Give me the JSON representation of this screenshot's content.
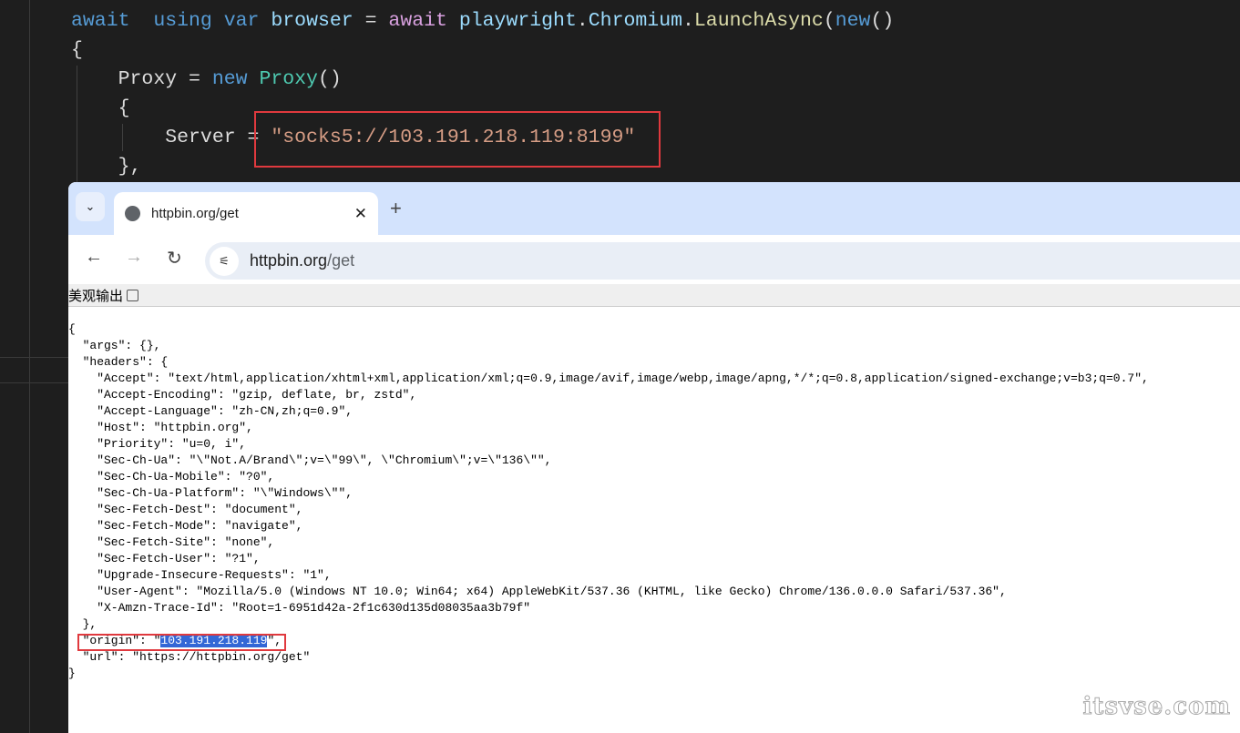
{
  "editor": {
    "lines": [
      {
        "parts": [
          [
            "kw",
            "await"
          ],
          [
            "",
            "  "
          ],
          [
            "kw",
            "using"
          ],
          [
            "",
            " "
          ],
          [
            "kw",
            "var"
          ],
          [
            "",
            " "
          ],
          [
            "id",
            "browser"
          ],
          [
            "",
            " = "
          ],
          [
            "ctl",
            "await"
          ],
          [
            "",
            " "
          ],
          [
            "id",
            "playwright"
          ],
          [
            "",
            "."
          ],
          [
            "id",
            "Chromium"
          ],
          [
            "",
            "."
          ],
          [
            "fn",
            "LaunchAsync"
          ],
          [
            "",
            "("
          ],
          [
            "kw",
            "new"
          ],
          [
            "",
            "()"
          ]
        ]
      },
      {
        "parts": [
          [
            "",
            "{"
          ]
        ]
      },
      {
        "parts": [
          [
            "",
            "    Proxy = "
          ],
          [
            "kw",
            "new"
          ],
          [
            "",
            " "
          ],
          [
            "ty",
            "Proxy"
          ],
          [
            "",
            "()"
          ]
        ]
      },
      {
        "parts": [
          [
            "",
            "    {"
          ]
        ]
      },
      {
        "parts": [
          [
            "",
            "        Server = "
          ],
          [
            "str",
            "\"socks5://103.191.218.119:8199\""
          ]
        ]
      },
      {
        "parts": [
          [
            "",
            "    },"
          ]
        ]
      }
    ]
  },
  "browser": {
    "tab_title": "httpbin.org/get",
    "url_host": "httpbin.org",
    "url_path": "/get",
    "pretty_print_label": "美观输出",
    "pretty_print_checked": false,
    "json_lines": [
      "{",
      "  \"args\": {},",
      "  \"headers\": {",
      "    \"Accept\": \"text/html,application/xhtml+xml,application/xml;q=0.9,image/avif,image/webp,image/apng,*/*;q=0.8,application/signed-exchange;v=b3;q=0.7\",",
      "    \"Accept-Encoding\": \"gzip, deflate, br, zstd\",",
      "    \"Accept-Language\": \"zh-CN,zh;q=0.9\",",
      "    \"Host\": \"httpbin.org\",",
      "    \"Priority\": \"u=0, i\",",
      "    \"Sec-Ch-Ua\": \"\\\"Not.A/Brand\\\";v=\\\"99\\\", \\\"Chromium\\\";v=\\\"136\\\"\",",
      "    \"Sec-Ch-Ua-Mobile\": \"?0\",",
      "    \"Sec-Ch-Ua-Platform\": \"\\\"Windows\\\"\",",
      "    \"Sec-Fetch-Dest\": \"document\",",
      "    \"Sec-Fetch-Mode\": \"navigate\",",
      "    \"Sec-Fetch-Site\": \"none\",",
      "    \"Sec-Fetch-User\": \"?1\",",
      "    \"Upgrade-Insecure-Requests\": \"1\",",
      "    \"User-Agent\": \"Mozilla/5.0 (Windows NT 10.0; Win64; x64) AppleWebKit/537.36 (KHTML, like Gecko) Chrome/136.0.0.0 Safari/537.36\",",
      "    \"X-Amzn-Trace-Id\": \"Root=1-6951d42a-2f1c630d135d08035aa3b79f\"",
      "  },"
    ],
    "origin_prefix": "  \"origin\": \"",
    "origin_value": "103.191.218.119",
    "origin_suffix": "\",",
    "json_tail": [
      "  \"url\": \"https://httpbin.org/get\"",
      "}"
    ]
  },
  "watermark": "itsvse.com"
}
